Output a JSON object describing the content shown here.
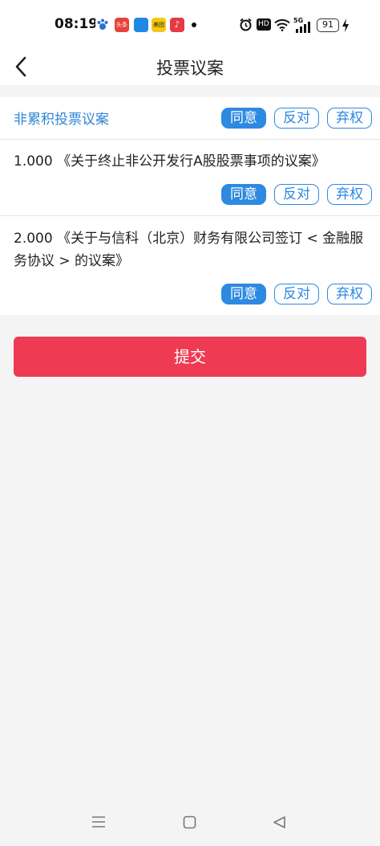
{
  "status": {
    "time": "08:19",
    "apps": [
      {
        "name": "paw-icon",
        "color": "#2f6fd6",
        "label": ""
      },
      {
        "name": "toutiao-icon",
        "color": "#e8413c",
        "label": "头条"
      },
      {
        "name": "blue-app-icon",
        "color": "#1e88e5",
        "label": ""
      },
      {
        "name": "meituan-icon",
        "color": "#f7c815",
        "label": "美团"
      },
      {
        "name": "music-icon",
        "color": "#e53945",
        "label": "♪"
      }
    ],
    "hd": "HD",
    "network": "5G",
    "battery": "91"
  },
  "nav": {
    "title": "投票议案"
  },
  "section": {
    "title": "非累积投票议案"
  },
  "vote_labels": {
    "agree": "同意",
    "oppose": "反对",
    "abstain": "弃权"
  },
  "items": [
    {
      "text": "1.000 《关于终止非公开发行A股股票事项的议案》"
    },
    {
      "text": "2.000 《关于与信科（北京）财务有限公司签订 < 金融服务协议 > 的议案》"
    }
  ],
  "submit": {
    "label": "提交"
  },
  "colors": {
    "accent": "#2e89e0",
    "submit": "#ee3a52"
  }
}
